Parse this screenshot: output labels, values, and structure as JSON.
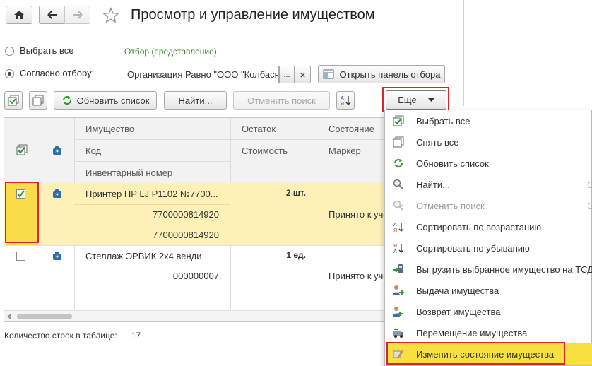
{
  "window": {
    "title": "Просмотр и управление имуществом"
  },
  "filter": {
    "select_all_label": "Выбрать все",
    "by_filter_label": "Согласно отбору:",
    "filter_link": "Отбор (представление)",
    "filter_value": "Организация Равно \"ООО \"Колбасн",
    "ellipsis_label": "...",
    "clear_label": "×",
    "open_panel_label": "Открыть панель отбора"
  },
  "toolbar": {
    "refresh_label": "Обновить список",
    "find_label": "Найти...",
    "cancel_search_label": "Отменить поиск",
    "more_label": "Еще"
  },
  "table": {
    "headers": {
      "property": "Имущество",
      "code": "Код",
      "inventory_number": "Инвентарный номер",
      "balance": "Остаток",
      "cost": "Стоимость",
      "state": "Состояние",
      "marker": "Маркер"
    },
    "rows": [
      {
        "checked": true,
        "name": "Принтер HP LJ P1102 №7700...",
        "code": "7700000814920",
        "inventory_number": "7700000814920",
        "balance": "2 шт.",
        "marker": "Принято к уче"
      },
      {
        "checked": false,
        "name": "Стеллаж ЭРВИК 2х4 венди",
        "code": "000000007",
        "balance": "1 ед.",
        "marker": "Принято к уче"
      }
    ]
  },
  "footer": {
    "rows_count_label": "Количество строк в таблице:",
    "rows_count_value": "17"
  },
  "menu": {
    "items": [
      {
        "label": "Выбрать все",
        "icon": "select-all-icon"
      },
      {
        "label": "Снять все",
        "icon": "deselect-all-icon"
      },
      {
        "label": "Обновить список",
        "icon": "refresh-icon"
      },
      {
        "label": "Найти...",
        "icon": "search-icon",
        "shortcut": "C"
      },
      {
        "label": "Отменить поиск",
        "icon": "cancel-search-icon",
        "shortcut": "C",
        "disabled": true
      },
      {
        "label": "Сортировать по возрастанию",
        "icon": "sort-asc-icon"
      },
      {
        "label": "Сортировать по убыванию",
        "icon": "sort-desc-icon"
      },
      {
        "label": "Выгрузить выбранное имущество на ТСД",
        "icon": "export-tsd-icon"
      },
      {
        "label": "Выдача имущества",
        "icon": "issue-property-icon"
      },
      {
        "label": "Возврат имущества",
        "icon": "return-property-icon"
      },
      {
        "label": "Перемещение имущества",
        "icon": "move-property-icon"
      },
      {
        "label": "Изменить состояние имущества",
        "icon": "change-state-icon",
        "highlighted": true
      }
    ]
  },
  "colors": {
    "highlight_yellow": "#fdf1b8",
    "selected_yellow": "#f9dc4a",
    "red_frame": "#d9262c",
    "green_link": "#3a8a2e",
    "menu_highlight": "#f9df3f"
  }
}
